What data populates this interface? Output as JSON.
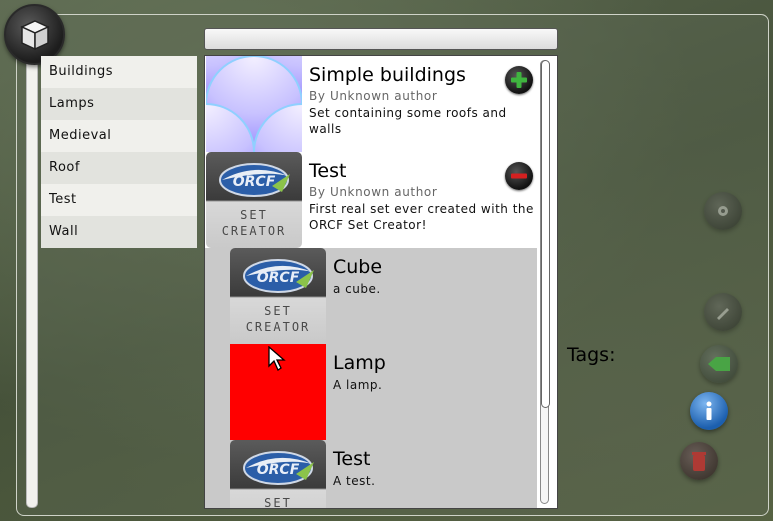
{
  "categories": [
    "Buildings",
    "Lamps",
    "Medieval",
    "Roof",
    "Test",
    "Wall"
  ],
  "sets": [
    {
      "name": "Simple buildings",
      "author": "By Unknown author",
      "description": "Set containing some roofs and walls",
      "action": "add",
      "thumbnail": "scallop-pattern",
      "color": "#3fb43f"
    },
    {
      "name": "Test",
      "author": "By Unknown author",
      "description": "First real set ever created with the ORCF Set Creator!",
      "action": "remove",
      "thumbnail": "set-creator-logo",
      "color": "#d42020"
    }
  ],
  "items": [
    {
      "name": "Cube",
      "description": "a cube.",
      "thumbnail": "set-creator-logo"
    },
    {
      "name": "Lamp",
      "description": "A lamp.",
      "thumbnail": "solid-red",
      "color": "#ff0000"
    },
    {
      "name": "Test",
      "description": "A test.",
      "thumbnail": "set-creator-logo"
    }
  ],
  "thumb_text": {
    "logo": "ORCF",
    "line1": "SET",
    "line2": "CREATOR"
  },
  "tags_label": "Tags:",
  "side_buttons": [
    "settings-icon",
    "edit-icon",
    "tag-icon",
    "info-icon",
    "delete-icon"
  ],
  "search": {
    "value": ""
  }
}
